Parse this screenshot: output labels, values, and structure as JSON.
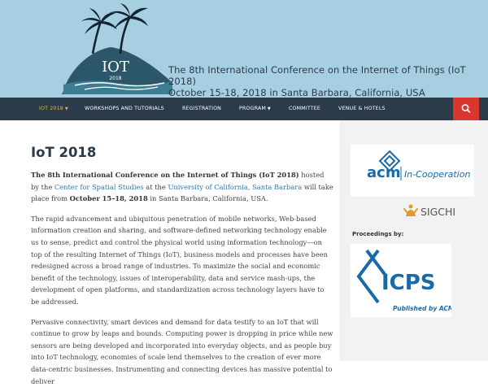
{
  "header": {
    "logo_text": "IOT",
    "logo_year": "2018",
    "conference_line1": "The 8th International Conference on the Internet of Things (IoT 2018)",
    "conference_line2": "October 15-18, 2018 in Santa Barbara, California, USA"
  },
  "nav": {
    "items": [
      {
        "label": "IOT 2018",
        "caret": "▼"
      },
      {
        "label": "WORKSHOPS AND TUTORIALS"
      },
      {
        "label": "REGISTRATION"
      },
      {
        "label": "PROGRAM",
        "caret": "▼"
      },
      {
        "label": "COMMITTEE"
      },
      {
        "label": "VENUE & HOTELS"
      }
    ],
    "search_icon": "search-icon"
  },
  "main": {
    "title": "IoT 2018",
    "p1_bold_a": "The 8th International Conference on the Internet of Things (IoT 2018)",
    "p1_t1": " hosted by the ",
    "p1_link1": "Center for Spatial Studies",
    "p1_t2": " at the ",
    "p1_link2": "University of California, Santa Barbara",
    "p1_t3": " will take place from ",
    "p1_bold_b": "October 15–18, 2018",
    "p1_t4": " in Santa Barbara, California, USA.",
    "p2": "The rapid advancement and ubiquitous penetration of mobile networks, Web-based information creation and sharing, and software-defined networking technology enable us to sense, predict and control the physical world using information technology—on top of the resulting Internet of Things (IoT), business models and processes have been redesigned across a broad range of industries. To maximize the social and economic benefit of the technology, issues of interoperability, data and service mash-ups, the development of open platforms, and standardization across technology layers have to be addressed.",
    "p3": "Pervasive connectivity, smart devices and demand for data testify to an IoT that will continue to grow by leaps and bounds. Computing power is dropping in price while new sensors are being developed and incorporated into everyday objects, and as people buy into IoT technology, economies of scale lend themselves to the creation of ever more data-centric businesses. Instrumenting and connecting devices has massive potential to deliver"
  },
  "sidebar": {
    "acm_logo_text": "acm",
    "acm_tagline": "In-Cooperation",
    "sigchi_text": "SIGCHI",
    "proceedings_label": "Proceedings by:",
    "icps_text": "ICPS",
    "icps_tagline": "Published by ACM"
  },
  "colors": {
    "banner_bg": "#a6cfe2",
    "nav_bg": "#2b3b4a",
    "nav_active": "#e8b25e",
    "search_bg": "#d9372e",
    "link": "#2b7bb0",
    "acm_blue": "#1a6aa8"
  }
}
